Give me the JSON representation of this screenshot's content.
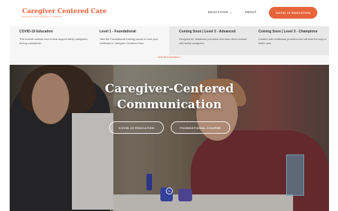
{
  "header": {
    "logo_title": "Caregiver Centered Care",
    "logo_subtitle": "Supporting Family Caregivers in Healthcare",
    "nav": [
      {
        "label": "EDUCATION",
        "caret": "⌄"
      },
      {
        "label": "ABOUT"
      }
    ],
    "cta_label": "COVID-19 EDUCATION"
  },
  "mega_menu": {
    "columns": [
      {
        "title": "COVID-19 Education",
        "description": "This module outlines how to best support family caregivers during a pandemic."
      },
      {
        "title": "Level 1 - Foundational",
        "description": "Take the Foundational training course to earn your certificate in Caregiver Centered Care."
      },
      {
        "title": "Coming Soon | Level 2 - Advanced",
        "description": "Designed for healthcare providers who have direct contact with family caregivers."
      },
      {
        "title": "Coming Soon | Level 3 - Champions",
        "description": "Created with healthcare providers who will lead the way to better care."
      }
    ],
    "view_all": "View All Education »"
  },
  "hero": {
    "title_line1": "Caregiver-Centered",
    "title_line2": "Communication",
    "buttons": [
      {
        "label": "COVID-19 EDUCATION"
      },
      {
        "label": "FOUNDATIONAL COURSE"
      }
    ],
    "scroll_icon": "chevron-down-icon"
  },
  "colors": {
    "accent": "#e8643a",
    "mega_bg": "#f6f6f6",
    "mega_highlight": "#e8e8e8"
  }
}
